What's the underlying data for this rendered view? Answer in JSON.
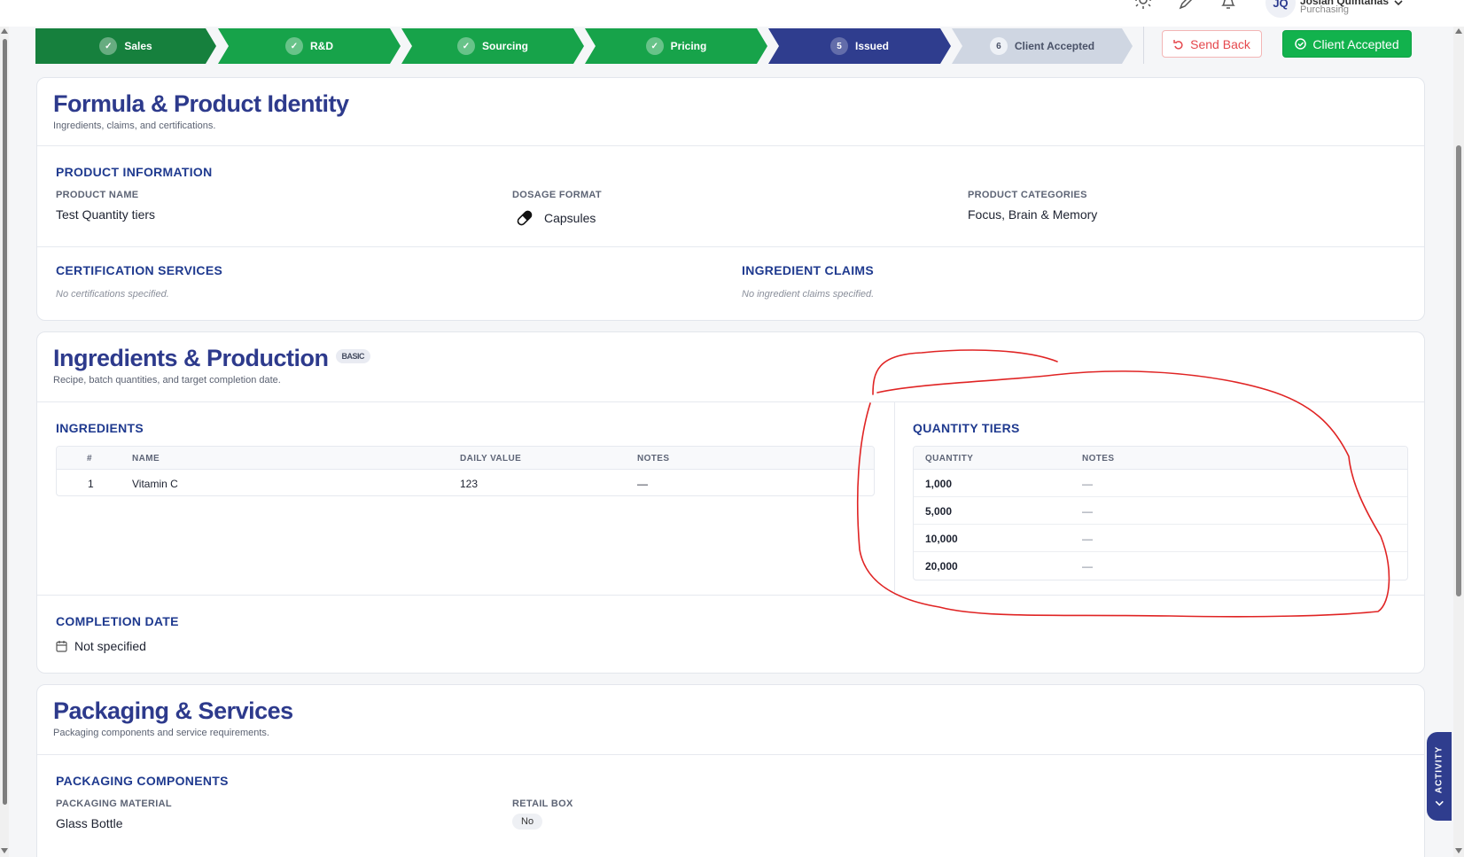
{
  "header": {
    "user_initials": "JQ",
    "user_name": "Josiah Quintanas",
    "user_role": "Purchasing",
    "icons": [
      "sun-icon",
      "edit-icon",
      "bell-icon",
      "chevron-down-icon"
    ]
  },
  "stepper": {
    "steps": [
      {
        "label": "Sales",
        "status": "done",
        "badge": "✓"
      },
      {
        "label": "R&D",
        "status": "done",
        "badge": "✓"
      },
      {
        "label": "Sourcing",
        "status": "done",
        "badge": "✓"
      },
      {
        "label": "Pricing",
        "status": "done",
        "badge": "✓"
      },
      {
        "label": "Issued",
        "status": "current",
        "badge": "5"
      },
      {
        "label": "Client Accepted",
        "status": "todo",
        "badge": "6"
      }
    ],
    "send_back_label": "Send Back",
    "client_accepted_label": "Client Accepted"
  },
  "formula": {
    "title": "Formula & Product Identity",
    "subtitle": "Ingredients, claims, and certifications.",
    "product_information_title": "PRODUCT INFORMATION",
    "product_name_label": "PRODUCT NAME",
    "product_name": "Test Quantity tiers",
    "dosage_format_label": "DOSAGE FORMAT",
    "dosage_format": "Capsules",
    "product_categories_label": "PRODUCT CATEGORIES",
    "product_categories": "Focus, Brain & Memory",
    "certification_title": "CERTIFICATION SERVICES",
    "certification_empty": "No certifications specified.",
    "claims_title": "INGREDIENT CLAIMS",
    "claims_empty": "No ingredient claims specified."
  },
  "ingredients": {
    "title": "Ingredients & Production",
    "tag": "BASIC",
    "subtitle": "Recipe, batch quantities, and target completion date.",
    "ingredients_title": "INGREDIENTS",
    "columns": [
      "#",
      "NAME",
      "DAILY VALUE",
      "NOTES"
    ],
    "rows": [
      {
        "num": "1",
        "name": "Vitamin C",
        "daily_value": "123",
        "notes": "—"
      }
    ],
    "tiers_title": "QUANTITY TIERS",
    "tier_columns": [
      "QUANTITY",
      "NOTES"
    ],
    "tiers": [
      {
        "quantity": "1,000",
        "notes": "—"
      },
      {
        "quantity": "5,000",
        "notes": "—"
      },
      {
        "quantity": "10,000",
        "notes": "—"
      },
      {
        "quantity": "20,000",
        "notes": "—"
      }
    ],
    "completion_title": "COMPLETION DATE",
    "completion_value": "Not specified"
  },
  "packaging": {
    "title": "Packaging & Services",
    "subtitle": "Packaging components and service requirements.",
    "components_title": "PACKAGING COMPONENTS",
    "material_label": "PACKAGING MATERIAL",
    "material_value": "Glass Bottle",
    "retail_box_label": "RETAIL BOX",
    "retail_box_value": "No"
  },
  "activity_label": "ACTIVITY",
  "colors": {
    "primary": "#2d3a8c",
    "success": "#17a34a",
    "danger": "#e5484d",
    "annotation": "#e02424"
  }
}
